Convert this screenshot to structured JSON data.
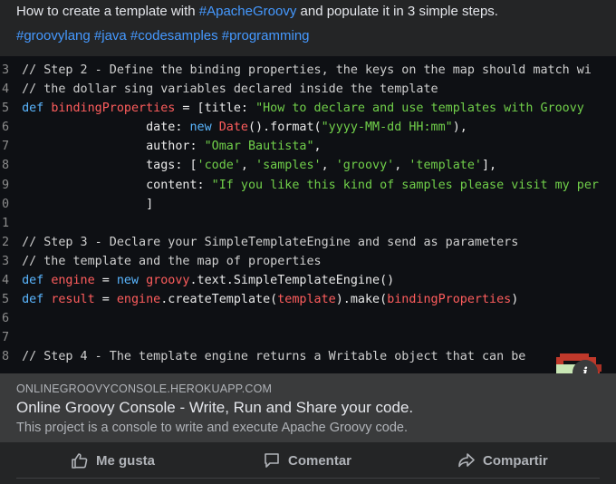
{
  "post": {
    "text_prefix": "How to create a template with ",
    "text_hashtag": "#ApacheGroovy",
    "text_suffix": " and populate it in 3 simple steps.",
    "hashtags": "#groovylang #java #codesamples #programming"
  },
  "code_lines": [
    {
      "n": "3",
      "segs": [
        [
          "cm",
          "// Step 2 - Define the binding properties, the keys on the map should match wi"
        ]
      ]
    },
    {
      "n": "4",
      "segs": [
        [
          "cm",
          "// the dollar sing variables declared inside the template"
        ]
      ]
    },
    {
      "n": "5",
      "segs": [
        [
          "kw",
          "def "
        ],
        [
          "vr",
          "bindingProperties"
        ],
        [
          "mt",
          " = [title: "
        ],
        [
          "st",
          "\"How to declare and use templates with Groovy"
        ]
      ]
    },
    {
      "n": "6",
      "segs": [
        [
          "mt",
          "                 date: "
        ],
        [
          "kw",
          "new "
        ],
        [
          "cl",
          "Date"
        ],
        [
          "mt",
          "().format("
        ],
        [
          "st",
          "\"yyyy-MM-dd HH:mm\""
        ],
        [
          "mt",
          "),"
        ]
      ]
    },
    {
      "n": "7",
      "segs": [
        [
          "mt",
          "                 author: "
        ],
        [
          "st",
          "\"Omar Bautista\""
        ],
        [
          "mt",
          ","
        ]
      ]
    },
    {
      "n": "8",
      "segs": [
        [
          "mt",
          "                 tags: ["
        ],
        [
          "st",
          "'code'"
        ],
        [
          "mt",
          ", "
        ],
        [
          "st",
          "'samples'"
        ],
        [
          "mt",
          ", "
        ],
        [
          "st",
          "'groovy'"
        ],
        [
          "mt",
          ", "
        ],
        [
          "st",
          "'template'"
        ],
        [
          "mt",
          "],"
        ]
      ]
    },
    {
      "n": "9",
      "segs": [
        [
          "mt",
          "                 content: "
        ],
        [
          "st",
          "\"If you like this kind of samples please visit my per"
        ]
      ]
    },
    {
      "n": "0",
      "segs": [
        [
          "mt",
          "                 ]"
        ]
      ]
    },
    {
      "n": "1",
      "segs": [
        [
          "mt",
          ""
        ]
      ]
    },
    {
      "n": "2",
      "segs": [
        [
          "cm",
          "// Step 3 - Declare your SimpleTemplateEngine and send as parameters"
        ]
      ]
    },
    {
      "n": "3",
      "segs": [
        [
          "cm",
          "// the template and the map of properties"
        ]
      ]
    },
    {
      "n": "4",
      "segs": [
        [
          "kw",
          "def "
        ],
        [
          "vr",
          "engine"
        ],
        [
          "mt",
          " = "
        ],
        [
          "kw",
          "new "
        ],
        [
          "cl",
          "groovy"
        ],
        [
          "mt",
          ".text.SimpleTemplateEngine()"
        ]
      ]
    },
    {
      "n": "5",
      "segs": [
        [
          "kw",
          "def "
        ],
        [
          "vr",
          "result"
        ],
        [
          "mt",
          " = "
        ],
        [
          "vr",
          "engine"
        ],
        [
          "mt",
          ".createTemplate("
        ],
        [
          "vr",
          "template"
        ],
        [
          "mt",
          ").make("
        ],
        [
          "vr",
          "bindingProperties"
        ],
        [
          "mt",
          ")"
        ]
      ]
    },
    {
      "n": "6",
      "segs": [
        [
          "mt",
          ""
        ]
      ]
    },
    {
      "n": "7",
      "segs": [
        [
          "mt",
          ""
        ]
      ]
    },
    {
      "n": "8",
      "segs": [
        [
          "cm",
          "// Step 4 - The template engine returns a Writable object that can be"
        ]
      ]
    }
  ],
  "info_label": "i",
  "link": {
    "domain": "ONLINEGROOVYCONSOLE.HEROKUAPP.COM",
    "title": "Online Groovy Console - Write, Run and Share your code.",
    "description": "This project is a console to write and execute Apache Groovy code."
  },
  "actions": {
    "like": "Me gusta",
    "comment": "Comentar",
    "share": "Compartir"
  },
  "colors": {
    "background": "#242526",
    "hashtag": "#4599ff",
    "card": "#3a3b3c",
    "code_bg": "#0e1014"
  },
  "icons": [
    "thumbs-up-icon",
    "comment-icon",
    "share-icon",
    "info-icon"
  ]
}
